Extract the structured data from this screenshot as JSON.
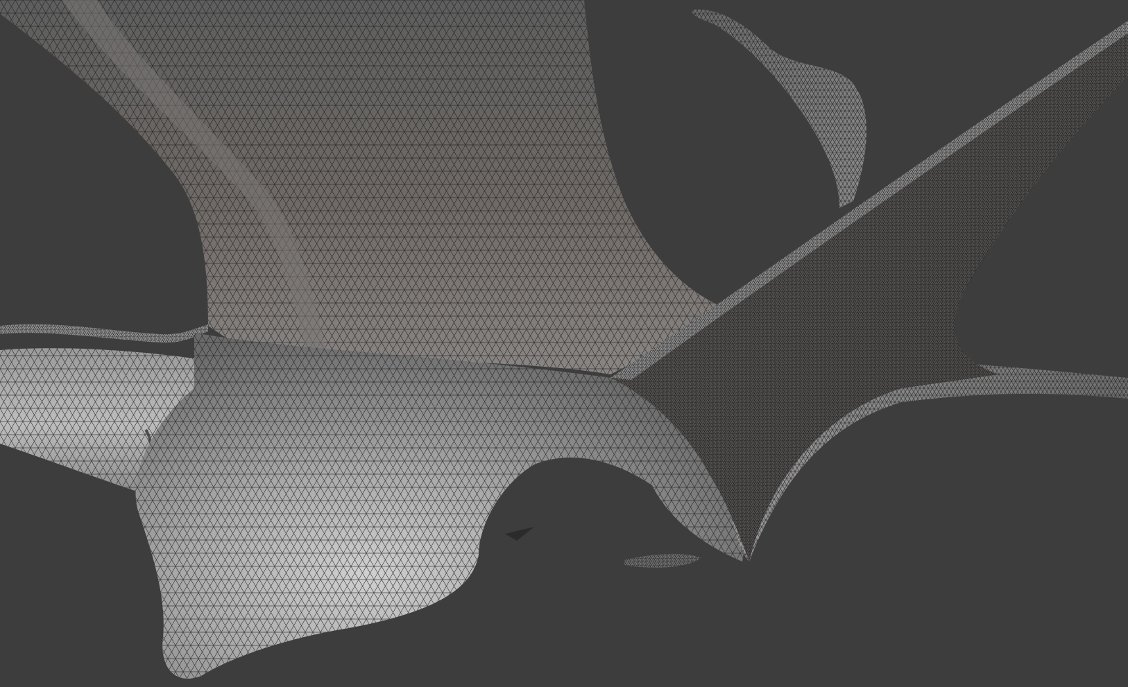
{
  "app": {
    "view": "3d-viewport",
    "shading": "wireframe-overlay"
  },
  "viewport": {
    "background_color": "#3d3d3d",
    "mesh": {
      "base_color": "#8c8c8c",
      "highlight_color": "#c9c9c9",
      "shadow_color": "#4a4a4a",
      "wire_color": "#1a1a1a",
      "warm_tint_color": "#7a6a5e"
    }
  }
}
